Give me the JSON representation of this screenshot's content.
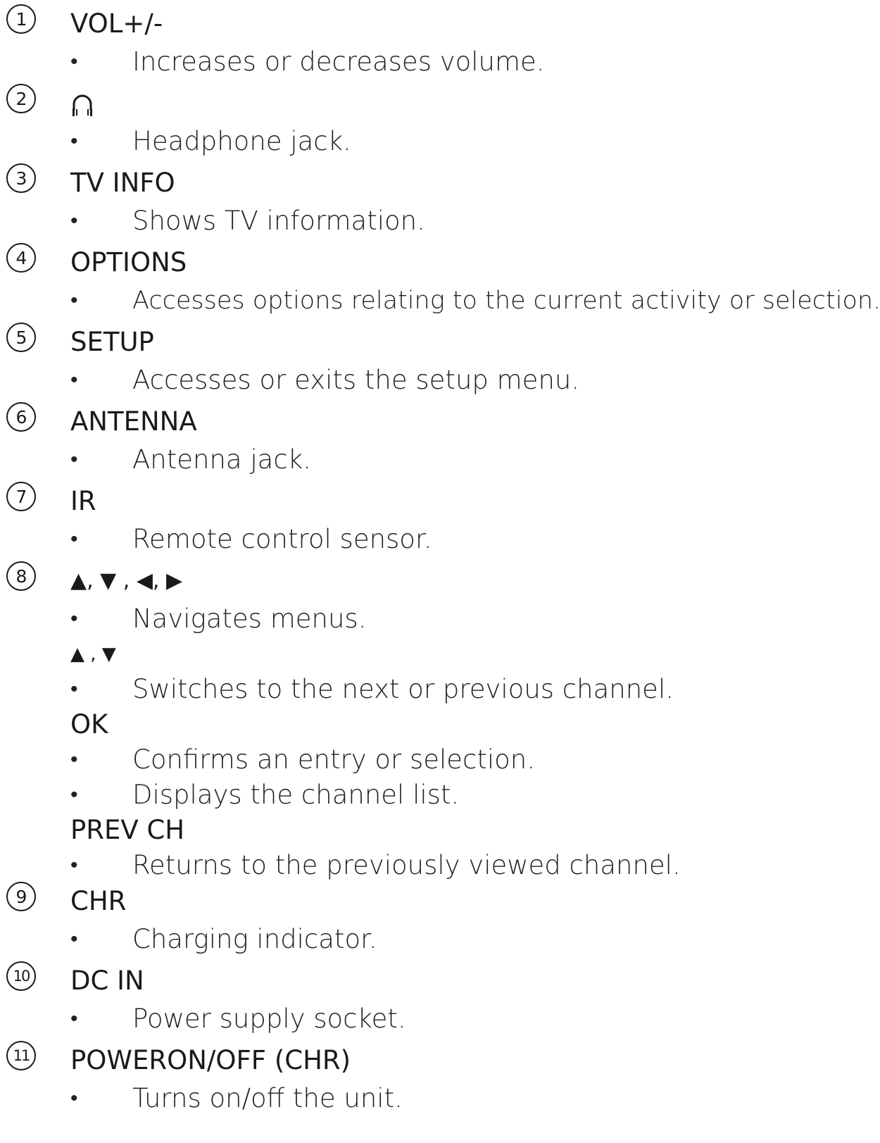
{
  "items": [
    {
      "number": "1",
      "label": "VOL+/-",
      "bullets": [
        "Increases or decreases volume."
      ]
    },
    {
      "number": "2",
      "icon": "headphone-icon",
      "bullets": [
        "Headphone jack."
      ]
    },
    {
      "number": "3",
      "label": "TV INFO",
      "bullets": [
        "Shows TV information."
      ]
    },
    {
      "number": "4",
      "label": "OPTIONS",
      "bullets": [
        "Accesses options relating to the current activity or selection."
      ]
    },
    {
      "number": "5",
      "label": "SETUP",
      "bullets": [
        "Accesses or exits the setup menu."
      ]
    },
    {
      "number": "6",
      "label": "ANTENNA",
      "bullets": [
        "Antenna jack."
      ]
    },
    {
      "number": "7",
      "label": "IR",
      "bullets": [
        "Remote control sensor."
      ]
    },
    {
      "number": "8",
      "label": "▲, ▼ , ◀, ▶",
      "bullets": [
        "Navigates menus."
      ],
      "sub": [
        {
          "label": "▲ , ▼",
          "bullets": [
            "Switches to the next or previous channel."
          ]
        },
        {
          "label": "OK",
          "bullets": [
            "Confirms an entry or selection.",
            "Displays the channel list."
          ]
        },
        {
          "label": "PREV CH",
          "bullets": [
            "Returns to the previously viewed channel."
          ]
        }
      ]
    },
    {
      "number": "9",
      "label": "CHR",
      "bullets": [
        "Charging indicator."
      ]
    },
    {
      "number": "10",
      "label": "DC IN",
      "bullets": [
        "Power supply socket."
      ]
    },
    {
      "number": "11",
      "label": "POWERON/OFF (CHR)",
      "bullets": [
        "Turns on/off the unit."
      ]
    }
  ]
}
